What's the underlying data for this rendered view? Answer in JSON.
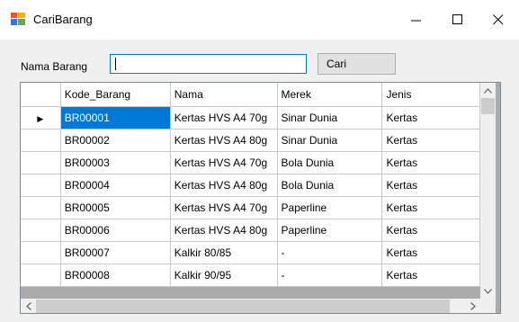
{
  "window": {
    "title": "CariBarang",
    "controls": {
      "minimize": "minimize",
      "maximize": "maximize",
      "close": "close"
    }
  },
  "search": {
    "label": "Nama Barang",
    "value": "",
    "button_label": "Cari"
  },
  "table": {
    "columns": [
      "Kode_Barang",
      "Nama",
      "Merek",
      "Jenis"
    ],
    "rows": [
      {
        "kode": "BR00001",
        "nama": "Kertas HVS A4 70g",
        "merek": "Sinar Dunia",
        "jenis": "Kertas"
      },
      {
        "kode": "BR00002",
        "nama": "Kertas HVS A4 80g",
        "merek": "Sinar Dunia",
        "jenis": "Kertas"
      },
      {
        "kode": "BR00003",
        "nama": "Kertas HVS A4 70g",
        "merek": "Bola Dunia",
        "jenis": "Kertas"
      },
      {
        "kode": "BR00004",
        "nama": "Kertas HVS A4 80g",
        "merek": "Bola Dunia",
        "jenis": "Kertas"
      },
      {
        "kode": "BR00005",
        "nama": "Kertas HVS A4 70g",
        "merek": "Paperline",
        "jenis": "Kertas"
      },
      {
        "kode": "BR00006",
        "nama": "Kertas HVS A4 80g",
        "merek": "Paperline",
        "jenis": "Kertas"
      },
      {
        "kode": "BR00007",
        "nama": "Kalkir 80/85",
        "merek": "-",
        "jenis": "Kertas"
      },
      {
        "kode": "BR00008",
        "nama": "Kalkir 90/95",
        "merek": "-",
        "jenis": "Kertas"
      }
    ],
    "current_row_indicator": "▶",
    "selected_row": 0
  },
  "colors": {
    "selection": "#0078d7",
    "focus_border": "#0078d7"
  }
}
